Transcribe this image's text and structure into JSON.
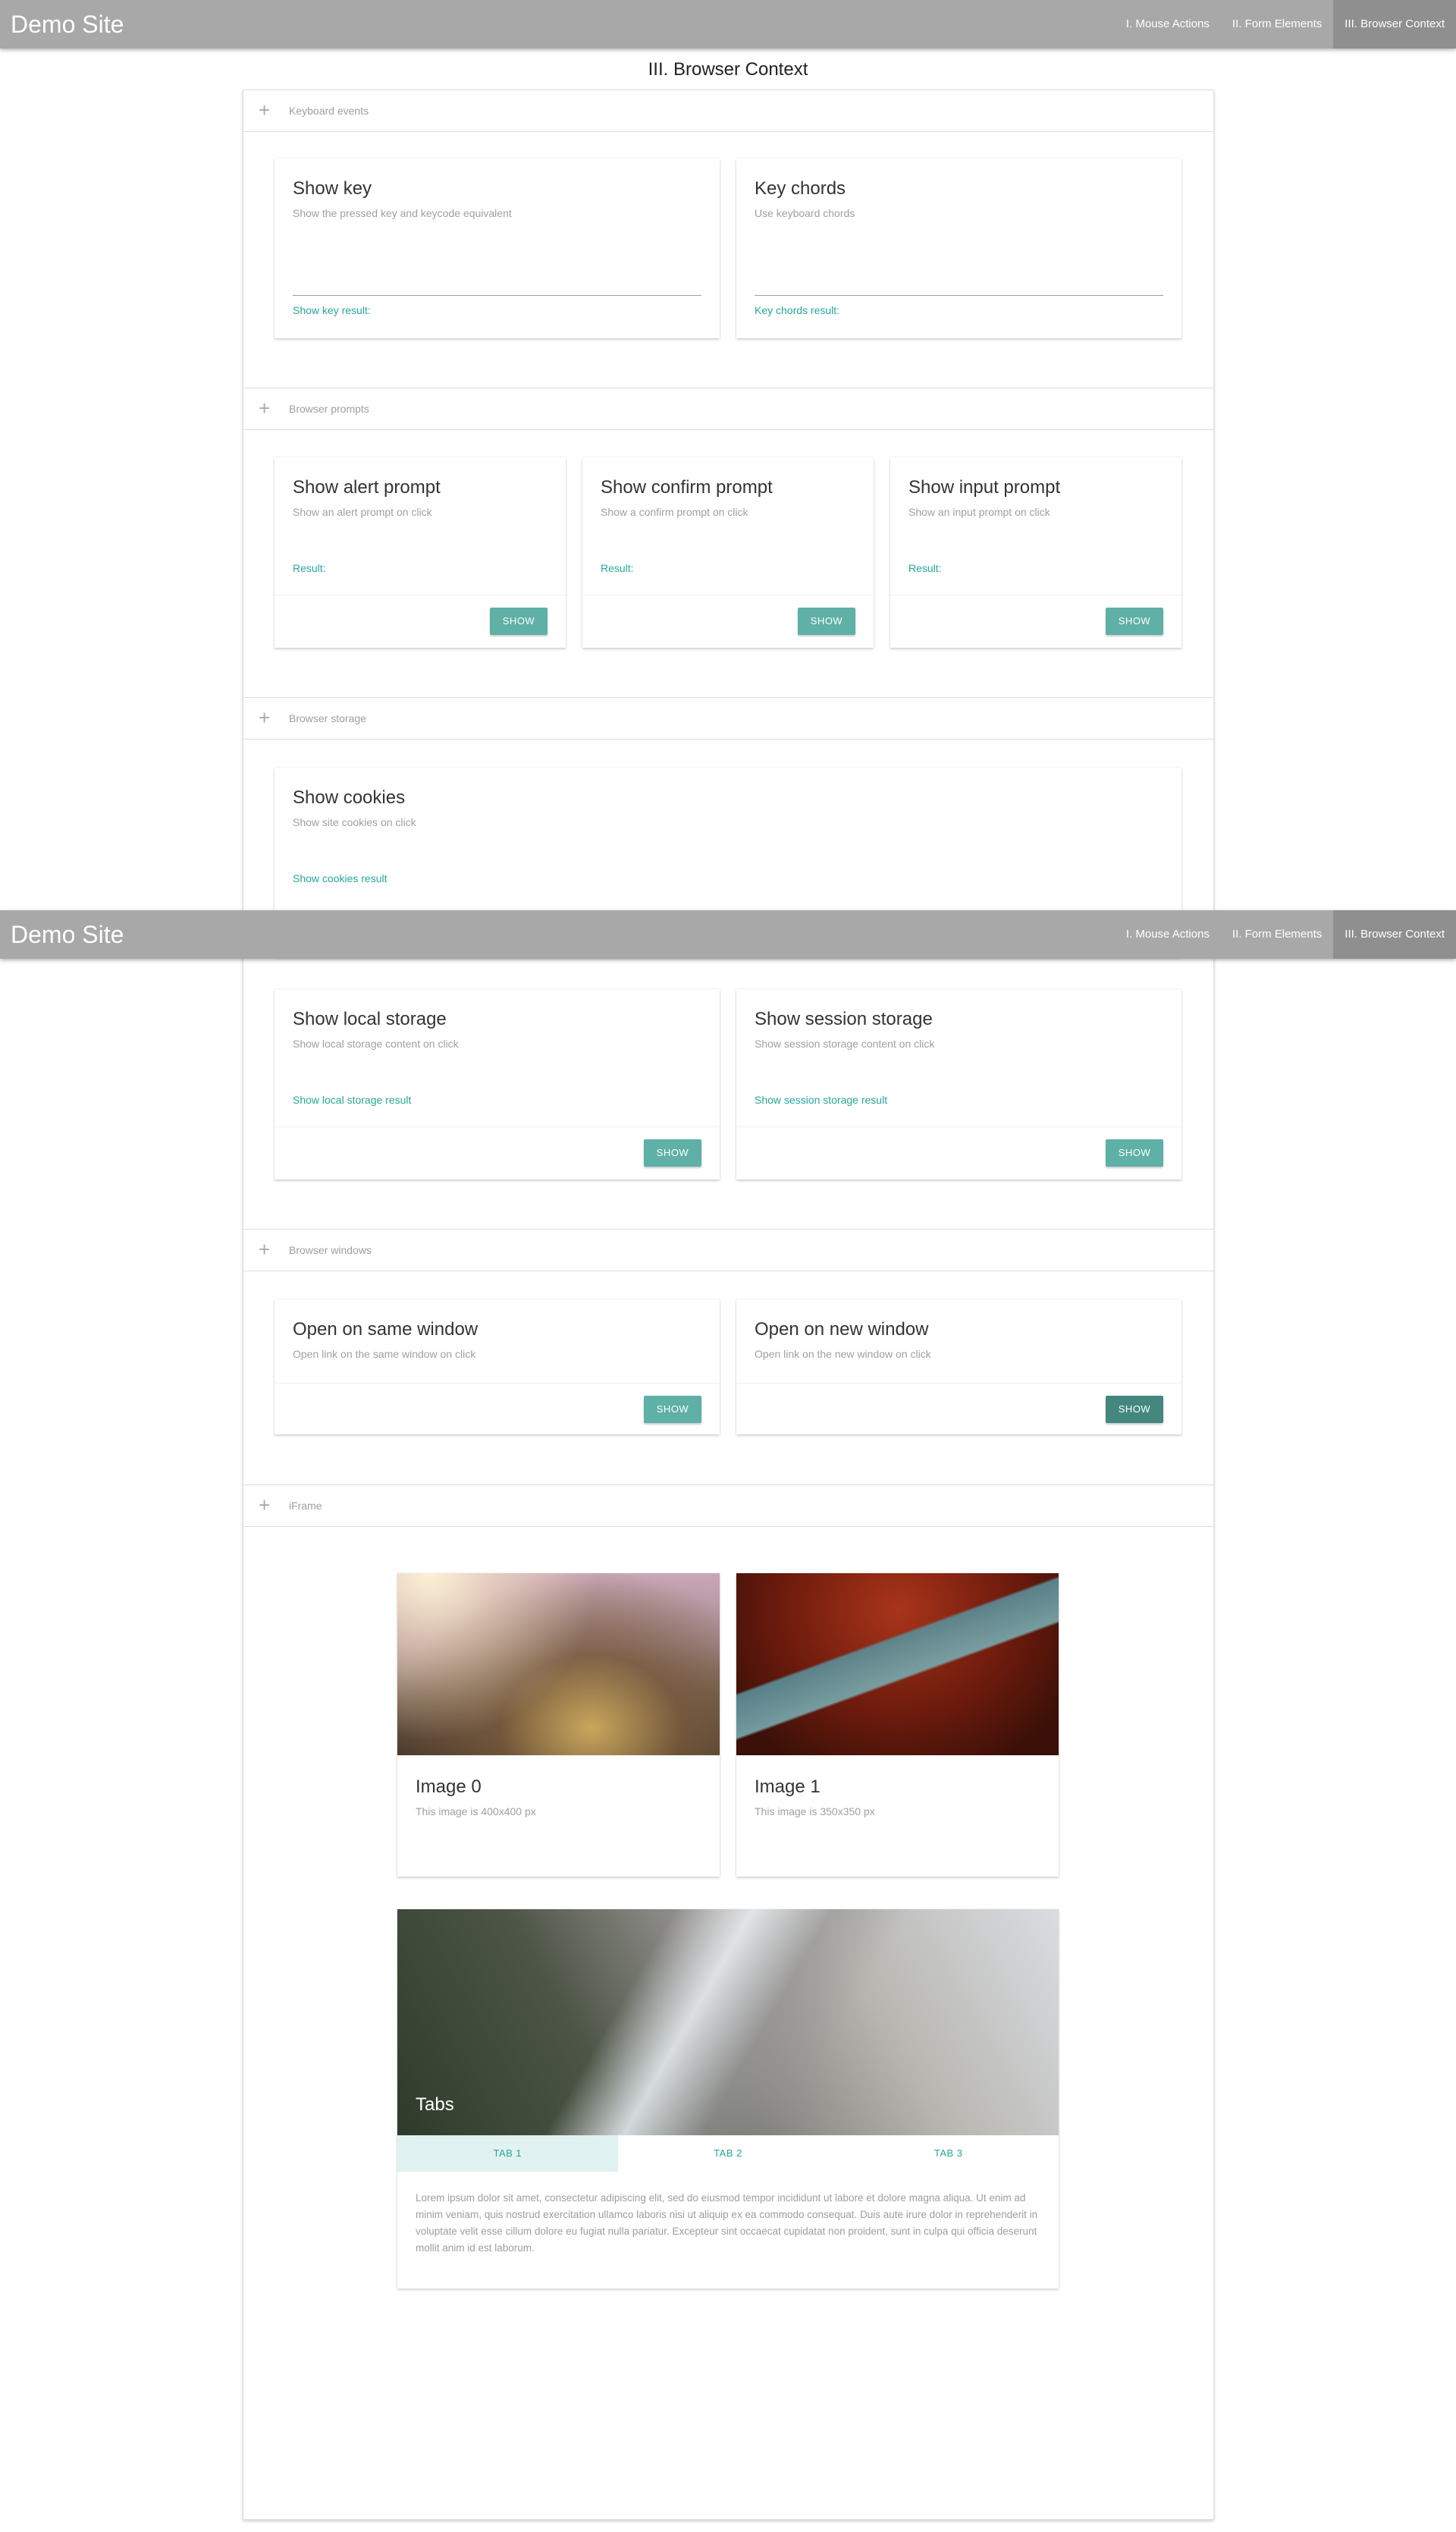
{
  "nav": {
    "brand": "Demo Site",
    "links": [
      "I. Mouse Actions",
      "II. Form Elements",
      "III. Browser Context"
    ],
    "active_index": 2
  },
  "page_title": "III. Browser Context",
  "sections": {
    "keyboard": {
      "header": "Keyboard events"
    },
    "prompts": {
      "header": "Browser prompts"
    },
    "storage": {
      "header": "Browser storage"
    },
    "windows": {
      "header": "Browser windows"
    },
    "iframe": {
      "header": "iFrame"
    }
  },
  "cards": {
    "show_key": {
      "title": "Show key",
      "desc": "Show the pressed key and keycode equivalent",
      "result": "Show key result:"
    },
    "key_chords": {
      "title": "Key chords",
      "desc": "Use keyboard chords",
      "result": "Key chords result:"
    },
    "alert": {
      "title": "Show alert prompt",
      "desc": "Show an alert prompt on click",
      "result": "Result:",
      "button": "SHOW"
    },
    "confirm": {
      "title": "Show confirm prompt",
      "desc": "Show a confirm prompt on click",
      "result": "Result:",
      "button": "SHOW"
    },
    "input": {
      "title": "Show input prompt",
      "desc": "Show an input prompt on click",
      "result": "Result:",
      "button": "SHOW"
    },
    "cookies": {
      "title": "Show cookies",
      "desc": "Show site cookies on click",
      "result": "Show cookies result"
    },
    "local": {
      "title": "Show local storage",
      "desc": "Show local storage content on click",
      "result": "Show local storage result",
      "button": "SHOW"
    },
    "session": {
      "title": "Show session storage",
      "desc": "Show session storage content on click",
      "result": "Show session storage result",
      "button": "SHOW"
    },
    "same_window": {
      "title": "Open on same window",
      "desc": "Open link on the same window on click",
      "button": "SHOW"
    },
    "new_window": {
      "title": "Open on new window",
      "desc": "Open link on the new window on click",
      "button": "SHOW"
    }
  },
  "images": [
    {
      "title": "Image 0",
      "desc": "This image is 400x400 px"
    },
    {
      "title": "Image 1",
      "desc": "This image is 350x350 px"
    }
  ],
  "tabs_card": {
    "title": "Tabs",
    "tabs": [
      "TAB 1",
      "TAB 2",
      "TAB 3"
    ],
    "active_index": 0,
    "content": "Lorem ipsum dolor sit amet, consectetur adipiscing elit, sed do eiusmod tempor incididunt ut labore et dolore magna aliqua. Ut enim ad minim veniam, quis nostrud exercitation ullamco laboris nisi ut aliquip ex ea commodo consequat. Duis aute irure dolor in reprehenderit in voluptate velit esse cillum dolore eu fugiat nulla pariatur. Excepteur sint occaecat cupidatat non proident, sunt in culpa qui officia deserunt mollit anim id est laborum."
  },
  "colors": {
    "accent": "#26a69a",
    "button": "#5fb0a6",
    "navbar": "#a8a8a8"
  }
}
